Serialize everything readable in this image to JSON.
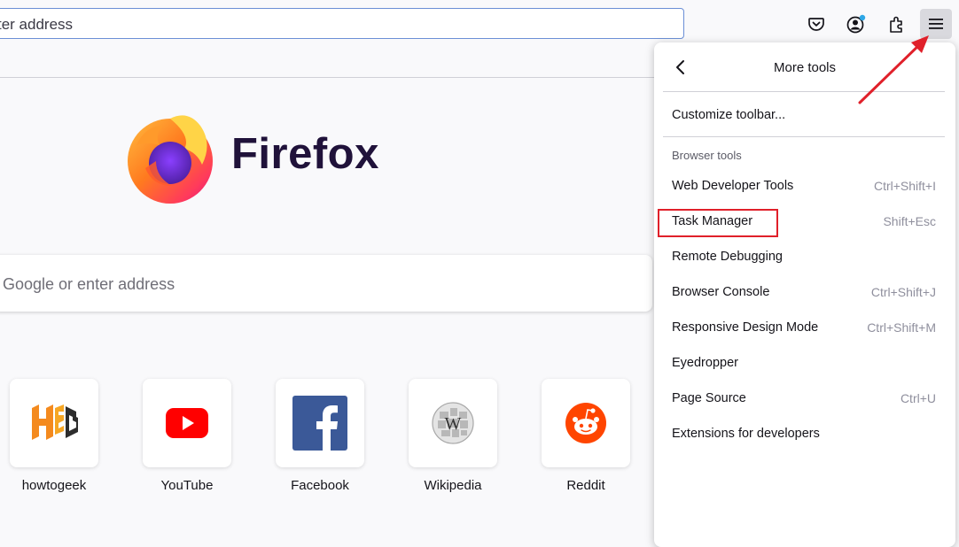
{
  "toolbar": {
    "url_placeholder": "ter address",
    "icons": [
      "pocket-icon",
      "account-icon",
      "extensions-icon",
      "hamburger-menu-icon"
    ]
  },
  "logo": {
    "wordmark": "Firefox"
  },
  "search": {
    "placeholder": "Google or enter address"
  },
  "top_sites": [
    {
      "label": "howtogeek",
      "icon": "howtogeek-icon"
    },
    {
      "label": "YouTube",
      "icon": "youtube-icon"
    },
    {
      "label": "Facebook",
      "icon": "facebook-icon"
    },
    {
      "label": "Wikipedia",
      "icon": "wikipedia-icon"
    },
    {
      "label": "Reddit",
      "icon": "reddit-icon"
    }
  ],
  "panel": {
    "title": "More tools",
    "customize": "Customize toolbar...",
    "section_label": "Browser tools",
    "items": [
      {
        "label": "Web Developer Tools",
        "shortcut": "Ctrl+Shift+I"
      },
      {
        "label": "Task Manager",
        "shortcut": "Shift+Esc"
      },
      {
        "label": "Remote Debugging",
        "shortcut": ""
      },
      {
        "label": "Browser Console",
        "shortcut": "Ctrl+Shift+J"
      },
      {
        "label": "Responsive Design Mode",
        "shortcut": "Ctrl+Shift+M"
      },
      {
        "label": "Eyedropper",
        "shortcut": ""
      },
      {
        "label": "Page Source",
        "shortcut": "Ctrl+U"
      },
      {
        "label": "Extensions for developers",
        "shortcut": ""
      }
    ]
  },
  "colors": {
    "accent_blue": "#6b8fd6",
    "annotation_red": "#e0202a",
    "firefox_dark": "#20123a"
  }
}
